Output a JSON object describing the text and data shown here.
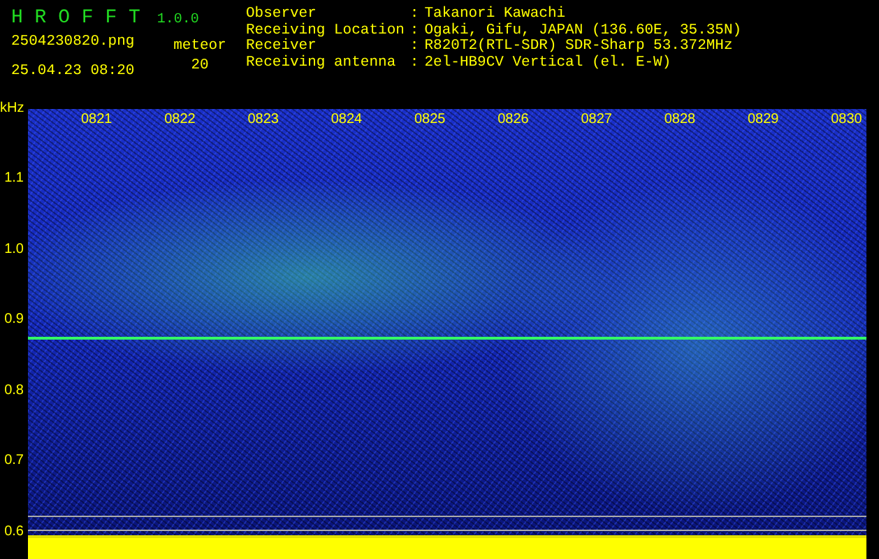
{
  "app": {
    "name": "H R O F F T",
    "version": "1.0.0"
  },
  "file": {
    "filename": "2504230820.png",
    "timestamp": "25.04.23 08:20",
    "meteor_label": "meteor",
    "meteor_count": "20"
  },
  "info": [
    {
      "label": "Observer",
      "separator": ":",
      "value": "Takanori Kawachi"
    },
    {
      "label": "Receiving Location",
      "separator": ":",
      "value": "Ogaki, Gifu, JAPAN (136.60E, 35.35N)"
    },
    {
      "label": "Receiver",
      "separator": ":",
      "value": "R820T2(RTL-SDR) SDR-Sharp 53.372MHz"
    },
    {
      "label": "Receiving antenna",
      "separator": ":",
      "value": "2el-HB9CV Vertical (el. E-W)"
    }
  ],
  "spectrogram": {
    "unit": "kHz",
    "time_labels": [
      "0821",
      "0822",
      "0823",
      "0824",
      "0825",
      "0826",
      "0827",
      "0828",
      "0829",
      "0830"
    ],
    "frequency_labels": [
      "1.1",
      "1.0",
      "0.9",
      "0.8",
      "0.7",
      "0.6"
    ]
  }
}
